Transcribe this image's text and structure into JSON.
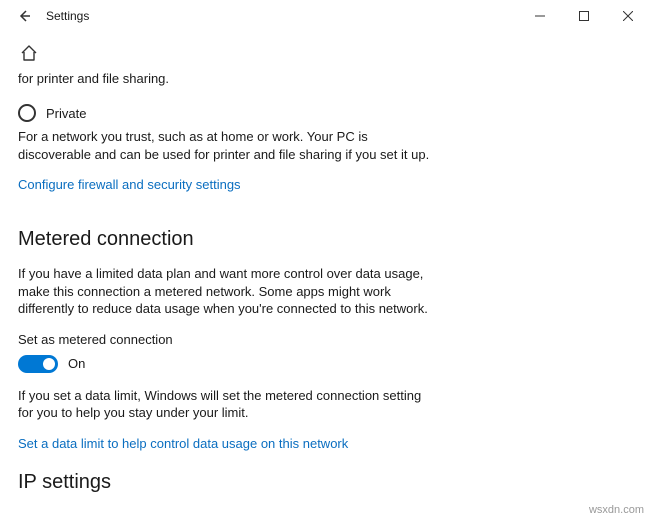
{
  "titlebar": {
    "title": "Settings"
  },
  "fragment_text": "for printer and file sharing.",
  "radio": {
    "private": {
      "label": "Private",
      "desc": "For a network you trust, such as at home or work. Your PC is discoverable and can be used for printer and file sharing if you set it up."
    }
  },
  "links": {
    "firewall": "Configure firewall and security settings",
    "data_limit": "Set a data limit to help control data usage on this network"
  },
  "metered": {
    "heading": "Metered connection",
    "desc": "If you have a limited data plan and want more control over data usage, make this connection a metered network. Some apps might work differently to reduce data usage when you're connected to this network.",
    "toggle_label": "Set as metered connection",
    "toggle_state": "On",
    "limit_note": "If you set a data limit, Windows will set the metered connection setting for you to help you stay under your limit."
  },
  "ip": {
    "heading": "IP settings"
  },
  "watermark": "wsxdn.com"
}
